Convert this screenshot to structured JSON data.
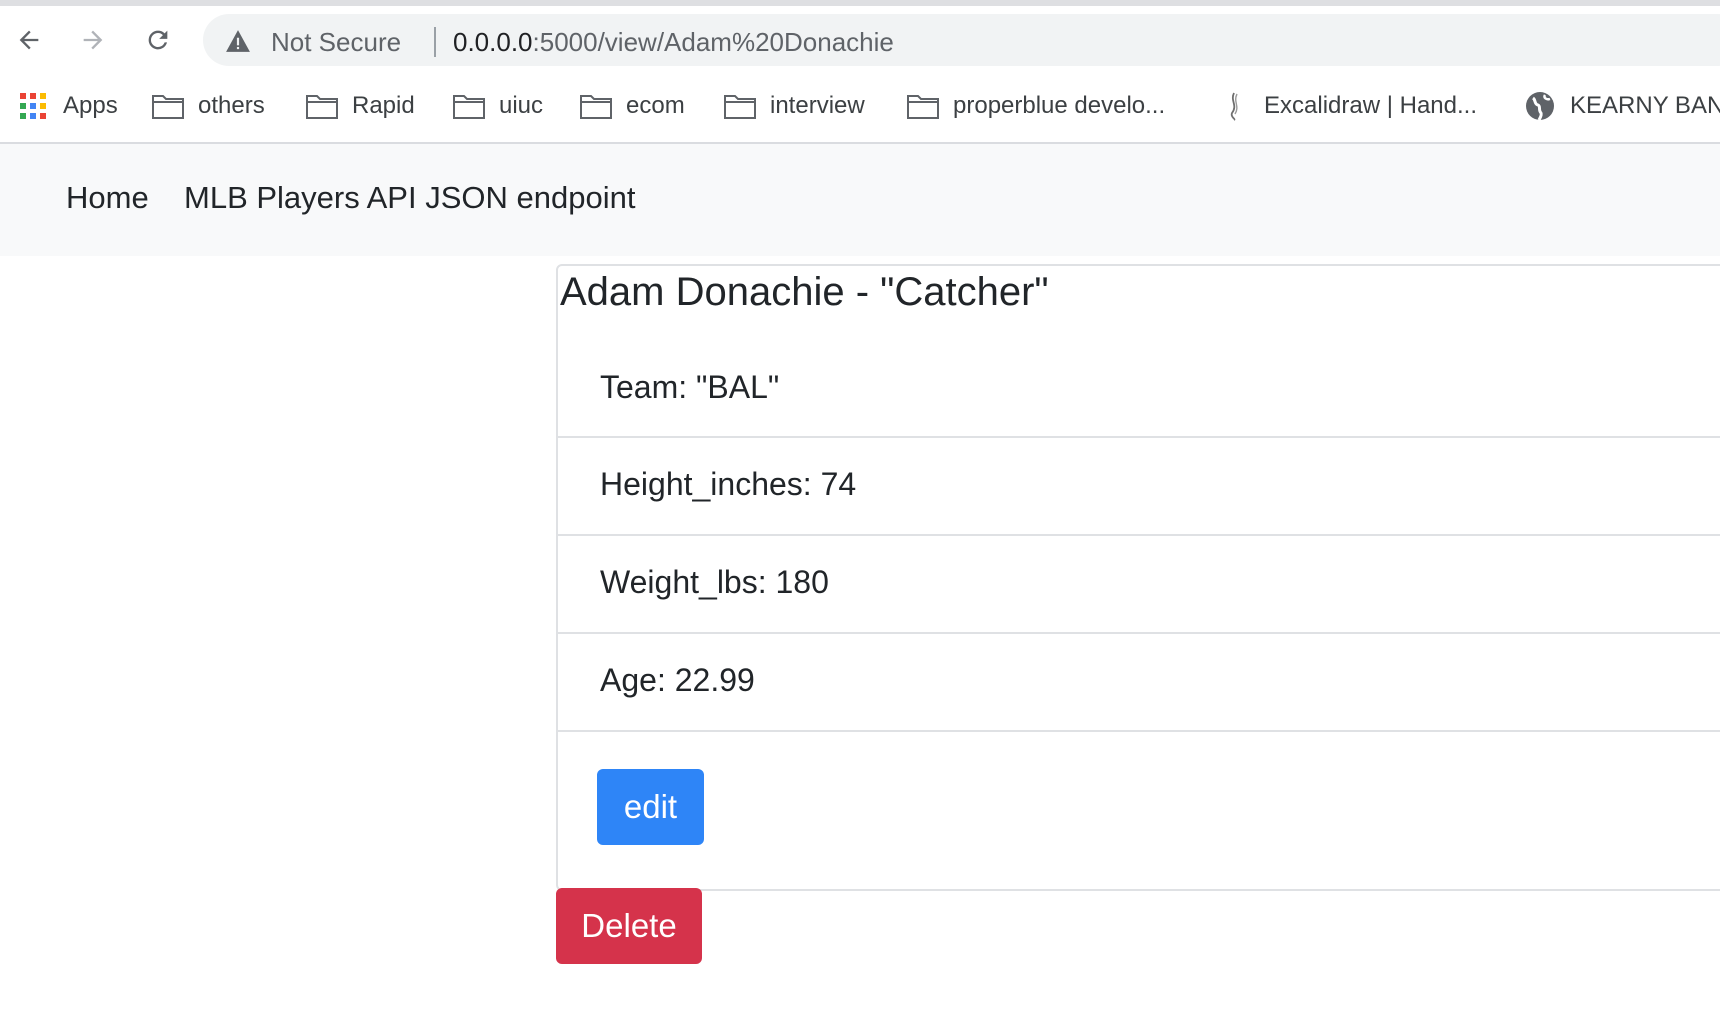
{
  "browser": {
    "security_label": "Not Secure",
    "url_host": "0.0.0.0",
    "url_rest": ":5000/view/Adam%20Donachie",
    "bookmarks": [
      {
        "label": "Apps",
        "icon": "apps-grid-icon"
      },
      {
        "label": "others",
        "icon": "folder-icon"
      },
      {
        "label": "Rapid",
        "icon": "folder-icon"
      },
      {
        "label": "uiuc",
        "icon": "folder-icon"
      },
      {
        "label": "ecom",
        "icon": "folder-icon"
      },
      {
        "label": "interview",
        "icon": "folder-icon"
      },
      {
        "label": "properblue develo...",
        "icon": "folder-icon"
      },
      {
        "label": "Excalidraw | Hand...",
        "icon": "excalidraw-icon"
      },
      {
        "label": "KEARNY BAN",
        "icon": "globe-icon"
      }
    ]
  },
  "navbar": {
    "home_label": "Home",
    "api_label": "MLB Players API JSON endpoint"
  },
  "player": {
    "title": "Adam Donachie - \"Catcher\"",
    "fields": [
      "Team: \"BAL\"",
      "Height_inches: 74",
      "Weight_lbs: 180",
      "Age: 22.99"
    ],
    "edit_label": "edit",
    "delete_label": "Delete"
  },
  "colors": {
    "edit_button": "#2e85f7",
    "delete_button": "#d5334b",
    "navbar_bg": "#f8f9fa"
  }
}
